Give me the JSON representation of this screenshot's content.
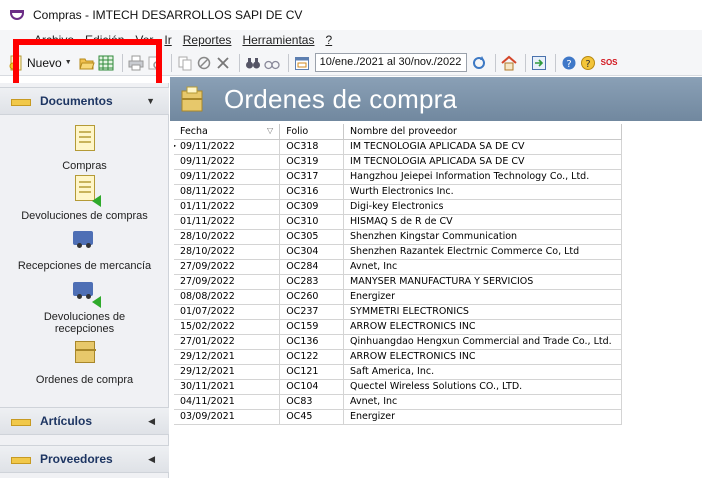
{
  "window": {
    "title": "Compras - IMTECH DESARROLLOS SAPI DE CV"
  },
  "menu": {
    "items": [
      {
        "label": "Archivo",
        "key": "A"
      },
      {
        "label": "Edición",
        "key": "E"
      },
      {
        "label": "Ver",
        "key": "V"
      },
      {
        "label": "Ir",
        "key": "I"
      },
      {
        "label": "Reportes",
        "key": "R"
      },
      {
        "label": "Herramientas",
        "key": "H"
      },
      {
        "label": "?",
        "key": "?"
      }
    ]
  },
  "toolbar": {
    "new_label": "Nuevo",
    "date_range": "10/ene./2021 al 30/nov./2022",
    "sos_label": "SOS"
  },
  "colors": {
    "header_bg": "#7d94ab",
    "highlight": "#ff0000",
    "sidebar_bg": "#f0f1f4"
  },
  "sidebar": {
    "documentos": {
      "label": "Documentos",
      "items": [
        {
          "label": "Compras",
          "icon": "document-icon"
        },
        {
          "label": "Devoluciones de compras",
          "icon": "document-return-icon"
        },
        {
          "label": "Recepciones de mercancía",
          "icon": "truck-icon"
        },
        {
          "label": "Devoluciones de recepciones",
          "icon": "truck-return-icon"
        },
        {
          "label": "Ordenes de compra",
          "icon": "box-icon"
        }
      ]
    },
    "articulos": {
      "label": "Artículos"
    },
    "proveedores": {
      "label": "Proveedores"
    }
  },
  "main": {
    "title": "Ordenes de compra",
    "columns": [
      "Fecha",
      "Folio",
      "Nombre del proveedor"
    ],
    "rows": [
      [
        "09/11/2022",
        "OC318",
        "IM TECNOLOGIA APLICADA SA DE CV"
      ],
      [
        "09/11/2022",
        "OC319",
        "IM TECNOLOGIA APLICADA SA DE CV"
      ],
      [
        "09/11/2022",
        "OC317",
        "Hangzhou Jeiepei Information Technology Co., Ltd."
      ],
      [
        "08/11/2022",
        "OC316",
        "Wurth Electronics Inc."
      ],
      [
        "01/11/2022",
        "OC309",
        "Digi-key Electronics"
      ],
      [
        "01/11/2022",
        "OC310",
        "HISMAQ S de R de CV"
      ],
      [
        "28/10/2022",
        "OC305",
        "Shenzhen Kingstar Communication"
      ],
      [
        "28/10/2022",
        "OC304",
        "Shenzhen Razantek Electrnic Commerce Co, Ltd"
      ],
      [
        "27/09/2022",
        "OC284",
        "Avnet, Inc"
      ],
      [
        "27/09/2022",
        "OC283",
        "MANYSER MANUFACTURA Y SERVICIOS"
      ],
      [
        "08/08/2022",
        "OC260",
        "Energizer"
      ],
      [
        "01/07/2022",
        "OC237",
        "SYMMETRI ELECTRONICS"
      ],
      [
        "15/02/2022",
        "OC159",
        "ARROW ELECTRONICS INC"
      ],
      [
        "27/01/2022",
        "OC136",
        "Qinhuangdao Hengxun Commercial and Trade Co., Ltd."
      ],
      [
        "29/12/2021",
        "OC122",
        "ARROW ELECTRONICS INC"
      ],
      [
        "29/12/2021",
        "OC121",
        "Saft America, Inc."
      ],
      [
        "30/11/2021",
        "OC104",
        "Quectel Wireless Solutions CO., LTD."
      ],
      [
        "04/11/2021",
        "OC83",
        "Avnet, Inc"
      ],
      [
        "03/09/2021",
        "OC45",
        "Energizer"
      ]
    ]
  }
}
